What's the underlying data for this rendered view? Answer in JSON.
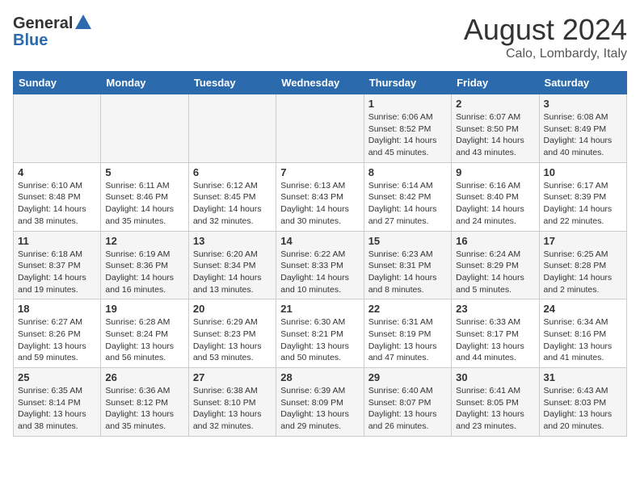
{
  "logo": {
    "general": "General",
    "blue": "Blue"
  },
  "title": "August 2024",
  "location": "Calo, Lombardy, Italy",
  "days": [
    "Sunday",
    "Monday",
    "Tuesday",
    "Wednesday",
    "Thursday",
    "Friday",
    "Saturday"
  ],
  "weeks": [
    [
      {
        "day": "",
        "content": ""
      },
      {
        "day": "",
        "content": ""
      },
      {
        "day": "",
        "content": ""
      },
      {
        "day": "",
        "content": ""
      },
      {
        "day": "1",
        "content": "Sunrise: 6:06 AM\nSunset: 8:52 PM\nDaylight: 14 hours\nand 45 minutes."
      },
      {
        "day": "2",
        "content": "Sunrise: 6:07 AM\nSunset: 8:50 PM\nDaylight: 14 hours\nand 43 minutes."
      },
      {
        "day": "3",
        "content": "Sunrise: 6:08 AM\nSunset: 8:49 PM\nDaylight: 14 hours\nand 40 minutes."
      }
    ],
    [
      {
        "day": "4",
        "content": "Sunrise: 6:10 AM\nSunset: 8:48 PM\nDaylight: 14 hours\nand 38 minutes."
      },
      {
        "day": "5",
        "content": "Sunrise: 6:11 AM\nSunset: 8:46 PM\nDaylight: 14 hours\nand 35 minutes."
      },
      {
        "day": "6",
        "content": "Sunrise: 6:12 AM\nSunset: 8:45 PM\nDaylight: 14 hours\nand 32 minutes."
      },
      {
        "day": "7",
        "content": "Sunrise: 6:13 AM\nSunset: 8:43 PM\nDaylight: 14 hours\nand 30 minutes."
      },
      {
        "day": "8",
        "content": "Sunrise: 6:14 AM\nSunset: 8:42 PM\nDaylight: 14 hours\nand 27 minutes."
      },
      {
        "day": "9",
        "content": "Sunrise: 6:16 AM\nSunset: 8:40 PM\nDaylight: 14 hours\nand 24 minutes."
      },
      {
        "day": "10",
        "content": "Sunrise: 6:17 AM\nSunset: 8:39 PM\nDaylight: 14 hours\nand 22 minutes."
      }
    ],
    [
      {
        "day": "11",
        "content": "Sunrise: 6:18 AM\nSunset: 8:37 PM\nDaylight: 14 hours\nand 19 minutes."
      },
      {
        "day": "12",
        "content": "Sunrise: 6:19 AM\nSunset: 8:36 PM\nDaylight: 14 hours\nand 16 minutes."
      },
      {
        "day": "13",
        "content": "Sunrise: 6:20 AM\nSunset: 8:34 PM\nDaylight: 14 hours\nand 13 minutes."
      },
      {
        "day": "14",
        "content": "Sunrise: 6:22 AM\nSunset: 8:33 PM\nDaylight: 14 hours\nand 10 minutes."
      },
      {
        "day": "15",
        "content": "Sunrise: 6:23 AM\nSunset: 8:31 PM\nDaylight: 14 hours\nand 8 minutes."
      },
      {
        "day": "16",
        "content": "Sunrise: 6:24 AM\nSunset: 8:29 PM\nDaylight: 14 hours\nand 5 minutes."
      },
      {
        "day": "17",
        "content": "Sunrise: 6:25 AM\nSunset: 8:28 PM\nDaylight: 14 hours\nand 2 minutes."
      }
    ],
    [
      {
        "day": "18",
        "content": "Sunrise: 6:27 AM\nSunset: 8:26 PM\nDaylight: 13 hours\nand 59 minutes."
      },
      {
        "day": "19",
        "content": "Sunrise: 6:28 AM\nSunset: 8:24 PM\nDaylight: 13 hours\nand 56 minutes."
      },
      {
        "day": "20",
        "content": "Sunrise: 6:29 AM\nSunset: 8:23 PM\nDaylight: 13 hours\nand 53 minutes."
      },
      {
        "day": "21",
        "content": "Sunrise: 6:30 AM\nSunset: 8:21 PM\nDaylight: 13 hours\nand 50 minutes."
      },
      {
        "day": "22",
        "content": "Sunrise: 6:31 AM\nSunset: 8:19 PM\nDaylight: 13 hours\nand 47 minutes."
      },
      {
        "day": "23",
        "content": "Sunrise: 6:33 AM\nSunset: 8:17 PM\nDaylight: 13 hours\nand 44 minutes."
      },
      {
        "day": "24",
        "content": "Sunrise: 6:34 AM\nSunset: 8:16 PM\nDaylight: 13 hours\nand 41 minutes."
      }
    ],
    [
      {
        "day": "25",
        "content": "Sunrise: 6:35 AM\nSunset: 8:14 PM\nDaylight: 13 hours\nand 38 minutes."
      },
      {
        "day": "26",
        "content": "Sunrise: 6:36 AM\nSunset: 8:12 PM\nDaylight: 13 hours\nand 35 minutes."
      },
      {
        "day": "27",
        "content": "Sunrise: 6:38 AM\nSunset: 8:10 PM\nDaylight: 13 hours\nand 32 minutes."
      },
      {
        "day": "28",
        "content": "Sunrise: 6:39 AM\nSunset: 8:09 PM\nDaylight: 13 hours\nand 29 minutes."
      },
      {
        "day": "29",
        "content": "Sunrise: 6:40 AM\nSunset: 8:07 PM\nDaylight: 13 hours\nand 26 minutes."
      },
      {
        "day": "30",
        "content": "Sunrise: 6:41 AM\nSunset: 8:05 PM\nDaylight: 13 hours\nand 23 minutes."
      },
      {
        "day": "31",
        "content": "Sunrise: 6:43 AM\nSunset: 8:03 PM\nDaylight: 13 hours\nand 20 minutes."
      }
    ]
  ]
}
